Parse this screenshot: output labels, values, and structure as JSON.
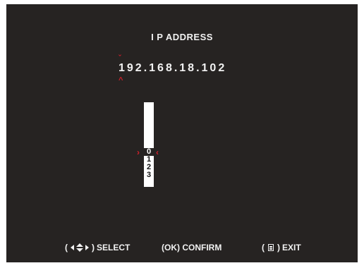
{
  "screen": {
    "title": "I P ADDRESS",
    "ip_value": "192.168.18.102"
  },
  "picker": {
    "digits": [
      "0",
      "1",
      "2",
      "3"
    ],
    "selected": "0"
  },
  "footer": {
    "select_open": "(",
    "select_close": ")",
    "select_label": "SELECT",
    "confirm_label": "(OK) CONFIRM",
    "exit_open": "(",
    "exit_close": ")",
    "exit_label": "EXIT"
  },
  "icons": {
    "navigation": "arrows-left-up-down-right-icon",
    "menu": "menu-icon"
  },
  "colors": {
    "background": "#262322",
    "accent": "#d21f2a",
    "text": "#f2f2f2"
  }
}
